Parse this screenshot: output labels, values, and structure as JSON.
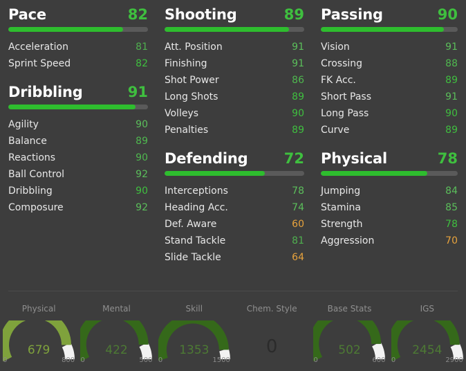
{
  "theme": {
    "background": "#3d3d3d",
    "bar_track": "#5a5a5a",
    "bar_fill": "#2ebd2e",
    "value_green": "#3fbf3f",
    "value_green_light": "#5bbf5b",
    "value_orange": "#e8a33d",
    "label_white": "#e8e8e8",
    "title_white": "#ffffff",
    "muted": "#8f8f8f"
  },
  "groups": [
    {
      "name": "Pace",
      "title": "Pace",
      "value": 82,
      "value_color": "#3fbf3f",
      "bar_pct": 82,
      "column": 0,
      "row": 0,
      "subs": [
        {
          "label": "Acceleration",
          "value": 81,
          "color": "#4fb04f"
        },
        {
          "label": "Sprint Speed",
          "value": 82,
          "color": "#3fbf3f"
        }
      ]
    },
    {
      "name": "Shooting",
      "title": "Shooting",
      "value": 89,
      "value_color": "#3fbf3f",
      "bar_pct": 89,
      "column": 1,
      "row": 0,
      "subs": [
        {
          "label": "Att. Position",
          "value": 91,
          "color": "#5bbf5b"
        },
        {
          "label": "Finishing",
          "value": 91,
          "color": "#5bbf5b"
        },
        {
          "label": "Shot Power",
          "value": 86,
          "color": "#4fb84f"
        },
        {
          "label": "Long Shots",
          "value": 89,
          "color": "#3fbf3f"
        },
        {
          "label": "Volleys",
          "value": 90,
          "color": "#3fbf3f"
        },
        {
          "label": "Penalties",
          "value": 89,
          "color": "#3fbf3f"
        }
      ]
    },
    {
      "name": "Passing",
      "title": "Passing",
      "value": 90,
      "value_color": "#3fbf3f",
      "bar_pct": 90,
      "column": 2,
      "row": 0,
      "subs": [
        {
          "label": "Vision",
          "value": 91,
          "color": "#5bbf5b"
        },
        {
          "label": "Crossing",
          "value": 88,
          "color": "#4fb84f"
        },
        {
          "label": "FK Acc.",
          "value": 89,
          "color": "#3fbf3f"
        },
        {
          "label": "Short Pass",
          "value": 91,
          "color": "#5bbf5b"
        },
        {
          "label": "Long Pass",
          "value": 90,
          "color": "#3fbf3f"
        },
        {
          "label": "Curve",
          "value": 89,
          "color": "#3fbf3f"
        }
      ]
    },
    {
      "name": "Dribbling",
      "title": "Dribbling",
      "value": 91,
      "value_color": "#3fbf3f",
      "bar_pct": 91,
      "column": 0,
      "row": 1,
      "subs": [
        {
          "label": "Agility",
          "value": 90,
          "color": "#5bbf5b"
        },
        {
          "label": "Balance",
          "value": 89,
          "color": "#4fb84f"
        },
        {
          "label": "Reactions",
          "value": 90,
          "color": "#4fb84f"
        },
        {
          "label": "Ball Control",
          "value": 92,
          "color": "#5bbf5b"
        },
        {
          "label": "Dribbling",
          "value": 90,
          "color": "#3fbf3f"
        },
        {
          "label": "Composure",
          "value": 92,
          "color": "#5bbf5b"
        }
      ]
    },
    {
      "name": "Defending",
      "title": "Defending",
      "value": 72,
      "value_color": "#3fbf3f",
      "bar_pct": 72,
      "column": 1,
      "row": 1,
      "subs": [
        {
          "label": "Interceptions",
          "value": 78,
          "color": "#5bbf5b"
        },
        {
          "label": "Heading Acc.",
          "value": 74,
          "color": "#5bbf5b"
        },
        {
          "label": "Def. Aware",
          "value": 60,
          "color": "#e8a33d"
        },
        {
          "label": "Stand Tackle",
          "value": 81,
          "color": "#4fb04f"
        },
        {
          "label": "Slide Tackle",
          "value": 64,
          "color": "#e8a33d"
        }
      ]
    },
    {
      "name": "Physical",
      "title": "Physical",
      "value": 78,
      "value_color": "#3fbf3f",
      "bar_pct": 78,
      "column": 2,
      "row": 1,
      "subs": [
        {
          "label": "Jumping",
          "value": 84,
          "color": "#5bbf5b"
        },
        {
          "label": "Stamina",
          "value": 85,
          "color": "#5bbf5b"
        },
        {
          "label": "Strength",
          "value": 78,
          "color": "#3fbf3f"
        },
        {
          "label": "Aggression",
          "value": 70,
          "color": "#e8a33d"
        }
      ]
    }
  ],
  "gauges": [
    {
      "name": "Physical",
      "label": "Physical",
      "value": 679,
      "min": 0,
      "max": 800,
      "min_label": "0",
      "max_label": "800",
      "arc_color": "#7fa23c",
      "value_color": "#7fa23c",
      "has_gauge": true
    },
    {
      "name": "Mental",
      "label": "Mental",
      "value": 422,
      "min": 0,
      "max": 500,
      "min_label": "0",
      "max_label": "500",
      "arc_color": "#35691a",
      "value_color": "#4d7a34",
      "has_gauge": true
    },
    {
      "name": "Skill",
      "label": "Skill",
      "value": 1353,
      "min": 0,
      "max": 1500,
      "min_label": "0",
      "max_label": "1500",
      "arc_color": "#35691a",
      "value_color": "#4d7a34",
      "has_gauge": true
    },
    {
      "name": "Chem. Style",
      "label": "Chem. Style",
      "value": 0,
      "min": 0,
      "max": 0,
      "min_label": "",
      "max_label": "",
      "arc_color": "",
      "value_color": "#2b2b2b",
      "has_gauge": false
    },
    {
      "name": "Base Stats",
      "label": "Base Stats",
      "value": 502,
      "min": 0,
      "max": 600,
      "min_label": "0",
      "max_label": "600",
      "arc_color": "#35691a",
      "value_color": "#4d7a34",
      "has_gauge": true
    },
    {
      "name": "IGS",
      "label": "IGS",
      "value": 2454,
      "min": 0,
      "max": 2900,
      "min_label": "0",
      "max_label": "2900",
      "arc_color": "#35691a",
      "value_color": "#4d7a34",
      "has_gauge": true
    }
  ]
}
